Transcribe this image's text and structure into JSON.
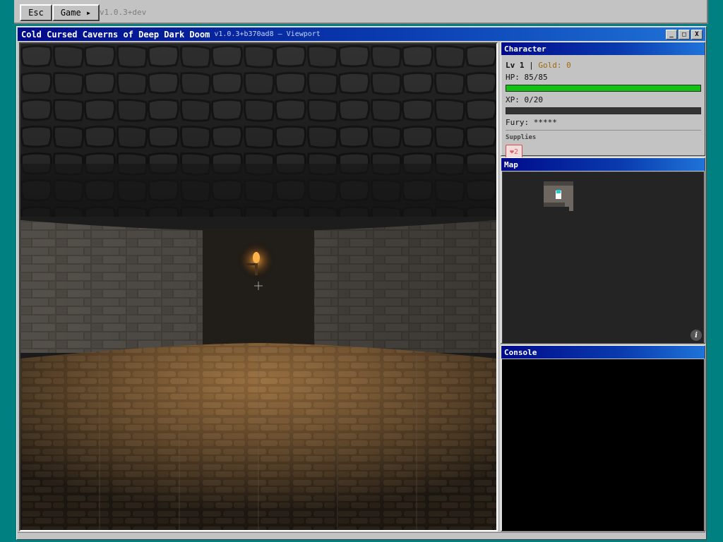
{
  "menubar": {
    "esc_label": "Esc",
    "game_label": "Game ▸",
    "version": "v1.0.3+dev"
  },
  "window": {
    "title": "Cold Cursed Caverns of Deep Dark Doom",
    "subtitle": "v1.0.3+b370ad8 — Viewport",
    "minimize_label": "_",
    "maximize_label": "□",
    "close_label": "X"
  },
  "character": {
    "header": "Character",
    "level_text": "Lv 1",
    "separator": "|",
    "gold_text": "Gold: 0",
    "hp_text": "HP: 85/85",
    "hp_fraction": 1.0,
    "xp_text": "XP: 0/20",
    "xp_fraction": 0.0,
    "fury_text": "Fury: *****",
    "supplies_label": "Supplies",
    "supply_item_label": "❤2"
  },
  "map": {
    "header": "Map",
    "info_label": "i"
  },
  "console": {
    "header": "Console"
  },
  "colors": {
    "desktop": "#008080",
    "title_bar": "#000a8a",
    "hp_bar": "#11c311",
    "gold": "#a06a10"
  }
}
